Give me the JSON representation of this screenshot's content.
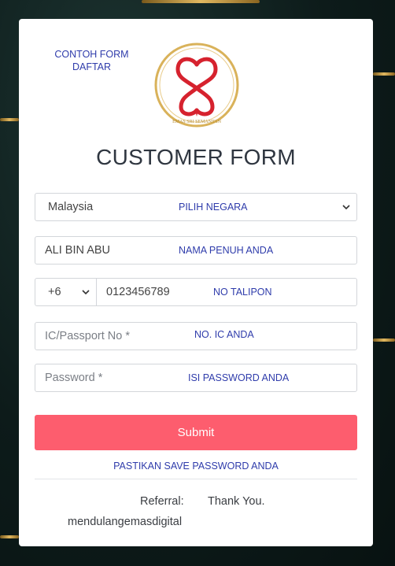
{
  "header_note": {
    "line1": "CONTOH FORM",
    "line2": "DAFTAR"
  },
  "logo": {
    "text": "EMAS SRI SEMANTAN"
  },
  "title": "CUSTOMER FORM",
  "country": {
    "value": "Malaysia",
    "hint": "PILIH NEGARA"
  },
  "name": {
    "value": "ALI BIN ABU",
    "hint": "NAMA PENUH ANDA"
  },
  "phone": {
    "code": "+6",
    "number": "0123456789",
    "hint": "NO TALIPON"
  },
  "ic": {
    "placeholder": "IC/Passport No *",
    "hint": "NO. IC ANDA"
  },
  "password": {
    "placeholder": "Password *",
    "hint": "ISI PASSWORD ANDA"
  },
  "submit_label": "Submit",
  "save_note": "PASTIKAN SAVE PASSWORD ANDA",
  "footer": {
    "referral_label": "Referral:",
    "thanks": "Thank You.",
    "referrer": "mendulangemasdigital"
  },
  "colors": {
    "accent": "#fd5d6e",
    "hint": "#2f3cab",
    "gold": "#d4a84a"
  }
}
